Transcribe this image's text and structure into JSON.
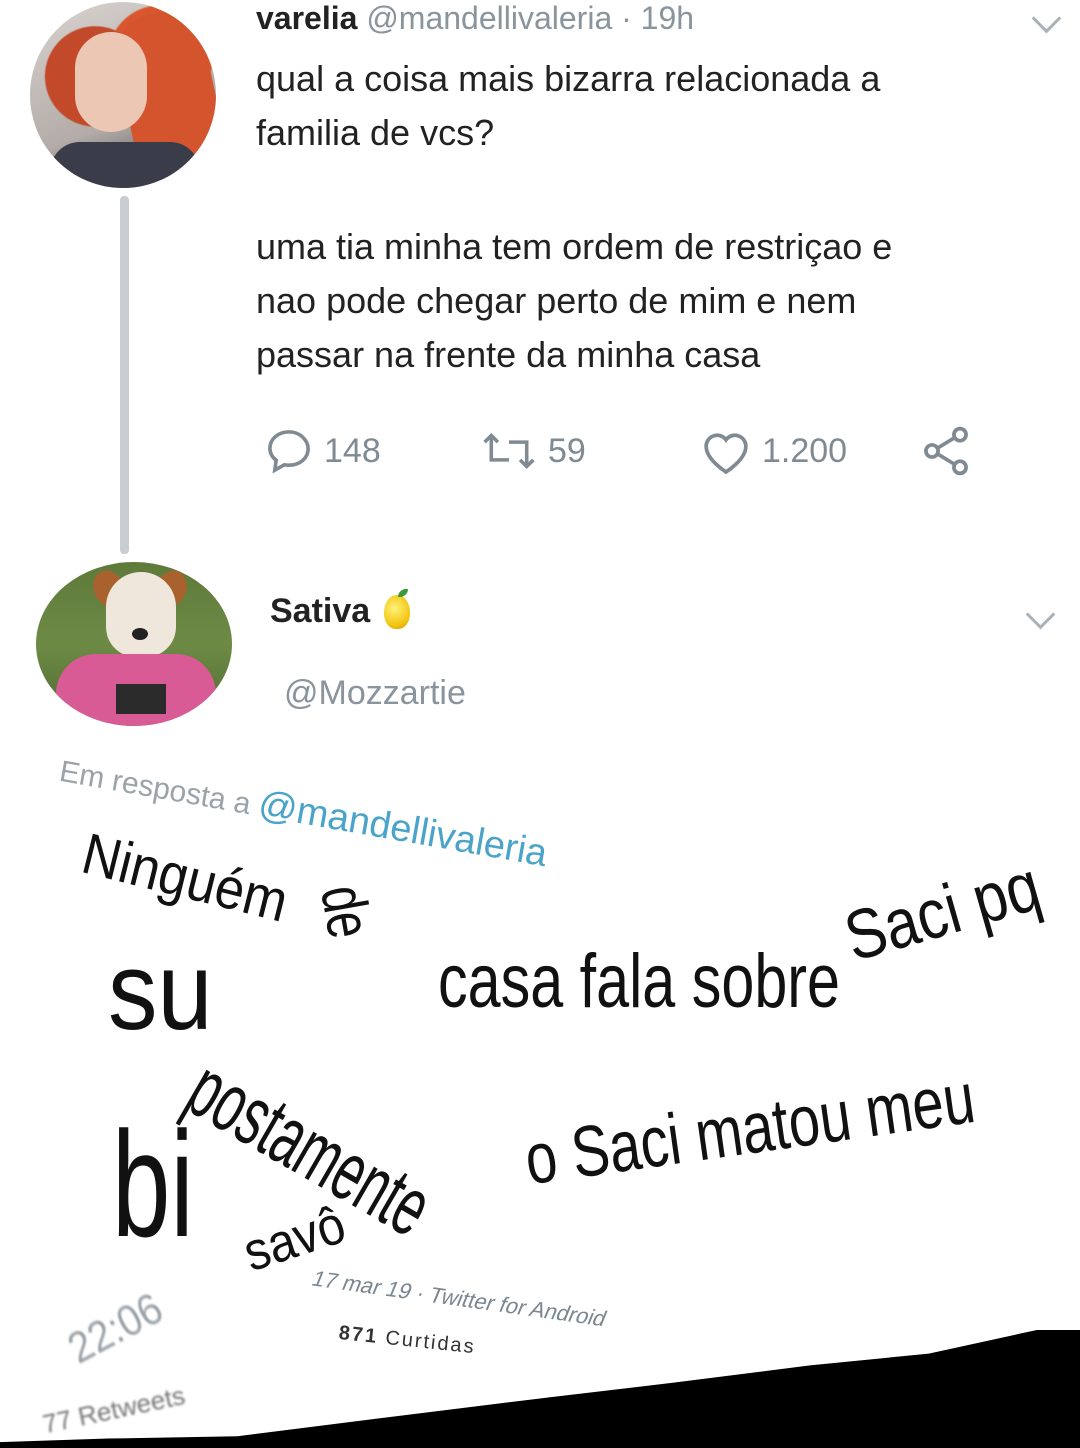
{
  "tweet1": {
    "name": "varelia",
    "handle": "@mandellivaleria",
    "dot": "·",
    "time": "19h",
    "question_line1": "qual a coisa mais bizarra relacionada a",
    "question_line2": "familia de vcs?",
    "body_line1": "uma tia minha tem ordem de restriçao e",
    "body_line2": "nao pode chegar perto de mim e nem",
    "body_line3": "passar na frente da minha casa",
    "replies": "148",
    "retweets": "59",
    "likes": "1.200",
    "icons": {
      "reply": "reply-icon",
      "retweet": "retweet-icon",
      "like": "heart-icon",
      "share": "share-icon",
      "menu": "chevron-down-icon"
    }
  },
  "tweet2": {
    "name": "Sativa",
    "emoji": "lemon-icon",
    "handle": "@Mozzartie",
    "reply_prefix": "Em resposta a",
    "reply_mention": "@mandellivaleria",
    "text": {
      "w1": "Ninguém",
      "w2": "de",
      "w3": "casa fala sobre",
      "w3b": "Saci pq",
      "w4": "su",
      "w5": "postamente",
      "w6": "o Saci matou meu",
      "w7": "bi",
      "w8": "savô"
    },
    "meta": "17 mar 19 · Twitter for Android",
    "time": "22:06",
    "likes_count": "871",
    "likes_label": "Curtidas",
    "retweets_count": "77",
    "retweets_label": "Retweets"
  },
  "colors": {
    "muted": "#8a949c",
    "mention": "#4aa3c9",
    "thread_line": "#c8cdd1"
  }
}
